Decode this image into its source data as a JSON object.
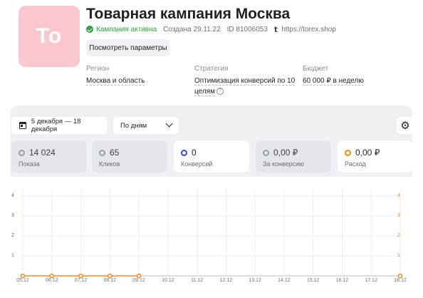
{
  "campaign": {
    "avatar_initials": "То",
    "avatar_color": "#fbc7cf",
    "title": "Товарная кампания Москва",
    "status": "Кампания активна",
    "status_color": "#2aa33b",
    "created": "Создана 29.11.22",
    "id": "ID 81006053",
    "site_icon": "tiktok-icon",
    "site": "https://torex.shop",
    "params_button": "Посмотреть параметры"
  },
  "info": {
    "region_label": "Регион",
    "region_value": "Москва и область",
    "strategy_label": "Стратегия",
    "strategy_line1": "Оптимизация конверсий по 10",
    "strategy_line2": "целям",
    "budget_label": "Бюджет",
    "budget_value": "60 000 ₽ в неделю"
  },
  "toolbar": {
    "date_range": "5 декабря — 18 декабря",
    "grouping": "По дням",
    "settings_icon": "gear-icon"
  },
  "stats": [
    {
      "value": "14 024",
      "label": "Показа",
      "active": false
    },
    {
      "value": "65",
      "label": "Кликов",
      "active": false
    },
    {
      "value": "0",
      "label": "Конверсий",
      "active": true,
      "color": "#2f4bd6"
    },
    {
      "value": "0,00 ₽",
      "label": "За конверсию",
      "active": false
    },
    {
      "value": "0,00 ₽",
      "label": "Расход",
      "active": true,
      "color": "#f08a1c"
    }
  ],
  "chart_data": {
    "type": "line",
    "x": [
      "05.12",
      "06.12",
      "07.12",
      "08.12",
      "09.12",
      "10.12",
      "11.12",
      "12.12",
      "13.12",
      "14.12",
      "15.12",
      "16.12",
      "17.12",
      "18.12"
    ],
    "y_left_ticks": [
      "4",
      "3",
      "2",
      "1"
    ],
    "y_right_ticks": [
      "4",
      "3",
      "2",
      "1"
    ],
    "ylim": [
      0,
      4
    ],
    "series": [
      {
        "color": "#f08a1c",
        "x": [
          "05.12",
          "06.12",
          "07.12",
          "08.12",
          "09.12",
          "18.12"
        ],
        "values": [
          0,
          0,
          0,
          0,
          0,
          0
        ]
      }
    ],
    "grid": true
  }
}
